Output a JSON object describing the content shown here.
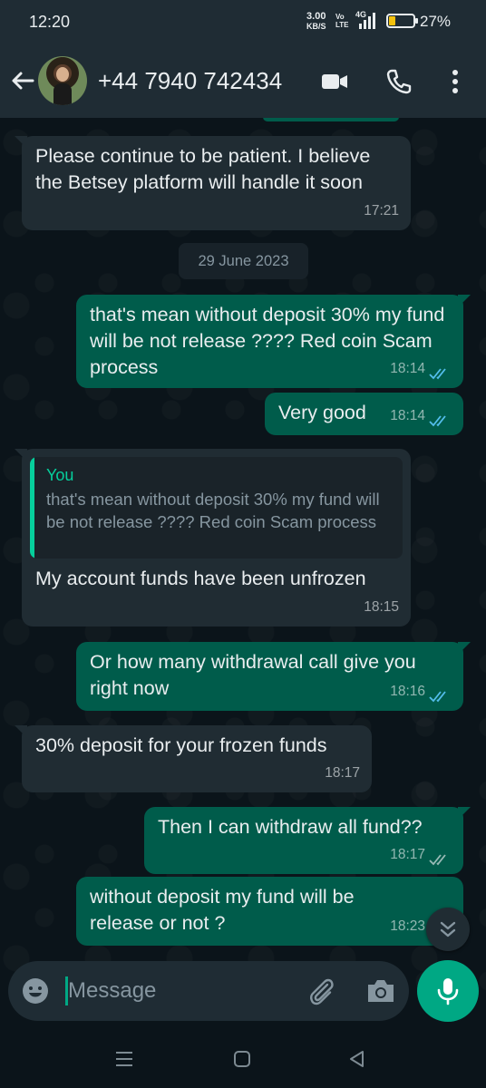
{
  "status_bar": {
    "time": "12:20",
    "speed_value": "3.00",
    "speed_unit": "KB/S",
    "volte_top": "Vo",
    "volte_bottom": "LTE",
    "network": "4G",
    "battery_percent": "27%",
    "battery_level": 0.27,
    "battery_color": "#f4c20d"
  },
  "header": {
    "contact_name": "+44 7940 742434",
    "back_icon": "arrow-left-icon",
    "video_icon": "video-call-icon",
    "call_icon": "phone-icon",
    "menu_icon": "more-vert-icon"
  },
  "chat": {
    "date_divider": "29 June 2023",
    "messages": [
      {
        "direction": "incoming",
        "text": "Please continue to be patient. I believe the Betsey platform will handle it soon",
        "time": "17:21"
      },
      {
        "direction": "outgoing",
        "text": "that's mean without deposit 30% my fund will be not release ???? Red coin Scam process",
        "time": "18:14",
        "status": "read"
      },
      {
        "direction": "outgoing",
        "text": "Very good",
        "time": "18:14",
        "status": "read"
      },
      {
        "direction": "incoming",
        "quote_author": "You",
        "quote_text": "that's mean without deposit 30% my fund will be not release ???? Red coin Scam process",
        "text": "My account funds have been unfrozen",
        "time": "18:15"
      },
      {
        "direction": "outgoing",
        "text": "Or how many withdrawal call give you right now",
        "time": "18:16",
        "status": "read"
      },
      {
        "direction": "incoming",
        "text": "30% deposit for your frozen funds",
        "time": "18:17"
      },
      {
        "direction": "outgoing",
        "text": "Then I can withdraw all fund??",
        "time": "18:17",
        "status": "delivered"
      },
      {
        "direction": "outgoing",
        "text": "without deposit my fund will be release or not ?",
        "time": "18:23",
        "status": "sent"
      }
    ]
  },
  "composer": {
    "placeholder": "Message",
    "emoji_icon": "emoji-icon",
    "attach_icon": "paperclip-icon",
    "camera_icon": "camera-icon",
    "mic_icon": "mic-icon"
  },
  "colors": {
    "incoming_bubble": "#202c33",
    "outgoing_bubble": "#005c4b",
    "accent": "#00a884",
    "read_ticks": "#53bdeb"
  }
}
